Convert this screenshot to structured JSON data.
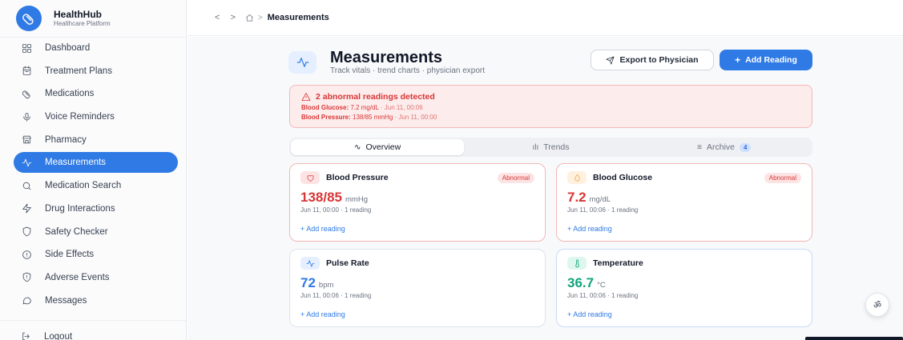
{
  "brand": {
    "name": "HealthHub",
    "subtitle": "Healthcare Platform"
  },
  "sidebar": {
    "items": [
      {
        "label": "Dashboard",
        "icon": "grid-icon",
        "active": false
      },
      {
        "label": "Treatment Plans",
        "icon": "calendar-icon",
        "active": false
      },
      {
        "label": "Medications",
        "icon": "pill-icon",
        "active": false
      },
      {
        "label": "Voice Reminders",
        "icon": "microphone-icon",
        "active": false
      },
      {
        "label": "Pharmacy",
        "icon": "store-icon",
        "active": false
      },
      {
        "label": "Measurements",
        "icon": "activity-icon",
        "active": true
      },
      {
        "label": "Medication Search",
        "icon": "search-icon",
        "active": false
      },
      {
        "label": "Drug Interactions",
        "icon": "zap-icon",
        "active": false
      },
      {
        "label": "Safety Checker",
        "icon": "shield-icon",
        "active": false
      },
      {
        "label": "Side Effects",
        "icon": "info-icon",
        "active": false
      },
      {
        "label": "Adverse Events",
        "icon": "alert-shield-icon",
        "active": false
      },
      {
        "label": "Messages",
        "icon": "message-icon",
        "active": false
      }
    ],
    "logout_label": "Logout"
  },
  "breadcrumb": {
    "current": "Measurements"
  },
  "page": {
    "title": "Measurements",
    "subtitle": "Track vitals · trend charts · physician export",
    "export_label": "Export to Physician",
    "add_label": "Add Reading"
  },
  "alert": {
    "heading": "2 abnormal readings detected",
    "lines": [
      {
        "label": "Blood Glucose:",
        "value": "7.2 mg/dL",
        "meta": "· Jun 11, 00:06"
      },
      {
        "label": "Blood Pressure:",
        "value": "138/85 mmHg",
        "meta": " · Jun 11, 00:00"
      }
    ]
  },
  "tabs": [
    {
      "label": "Overview",
      "icon": "∿",
      "active": true
    },
    {
      "label": "Trends",
      "icon": "ılı",
      "active": false
    },
    {
      "label": "Archive",
      "icon": "≡",
      "count": "4",
      "active": false
    }
  ],
  "cards": [
    {
      "title": "Blood Pressure",
      "badge": "Abnormal",
      "value": "138/85",
      "unit": "mmHg",
      "meta": "Jun 11, 00:00 · 1 reading",
      "add": "+ Add reading",
      "icon": "heart-icon",
      "value_color": "#d93636",
      "icon_color": "#e05252",
      "icon_bg": "#fde4e4"
    },
    {
      "title": "Blood Glucose",
      "badge": "Abnormal",
      "value": "7.2",
      "unit": "mg/dL",
      "meta": "Jun 11, 00:06 · 1 reading",
      "add": "+ Add reading",
      "icon": "droplet-icon",
      "value_color": "#d93636",
      "icon_color": "#f0a54a",
      "icon_bg": "#fff1de"
    },
    {
      "title": "Pulse Rate",
      "badge": "",
      "value": "72",
      "unit": "bpm",
      "meta": "Jun 11, 00:06 · 1 reading",
      "add": "+ Add reading",
      "icon": "activity-icon",
      "value_color": "#2f7ae5",
      "icon_color": "#2f7ae5",
      "icon_bg": "#e6efff"
    },
    {
      "title": "Temperature",
      "badge": "",
      "value": "36.7",
      "unit": "°C",
      "meta": "Jun 11, 00:06 · 1 reading",
      "add": "+ Add reading",
      "icon": "thermometer-icon",
      "value_color": "#12a37c",
      "icon_color": "#12a37c",
      "icon_bg": "#def7ee"
    }
  ],
  "fab": {
    "label": "ॐ"
  }
}
